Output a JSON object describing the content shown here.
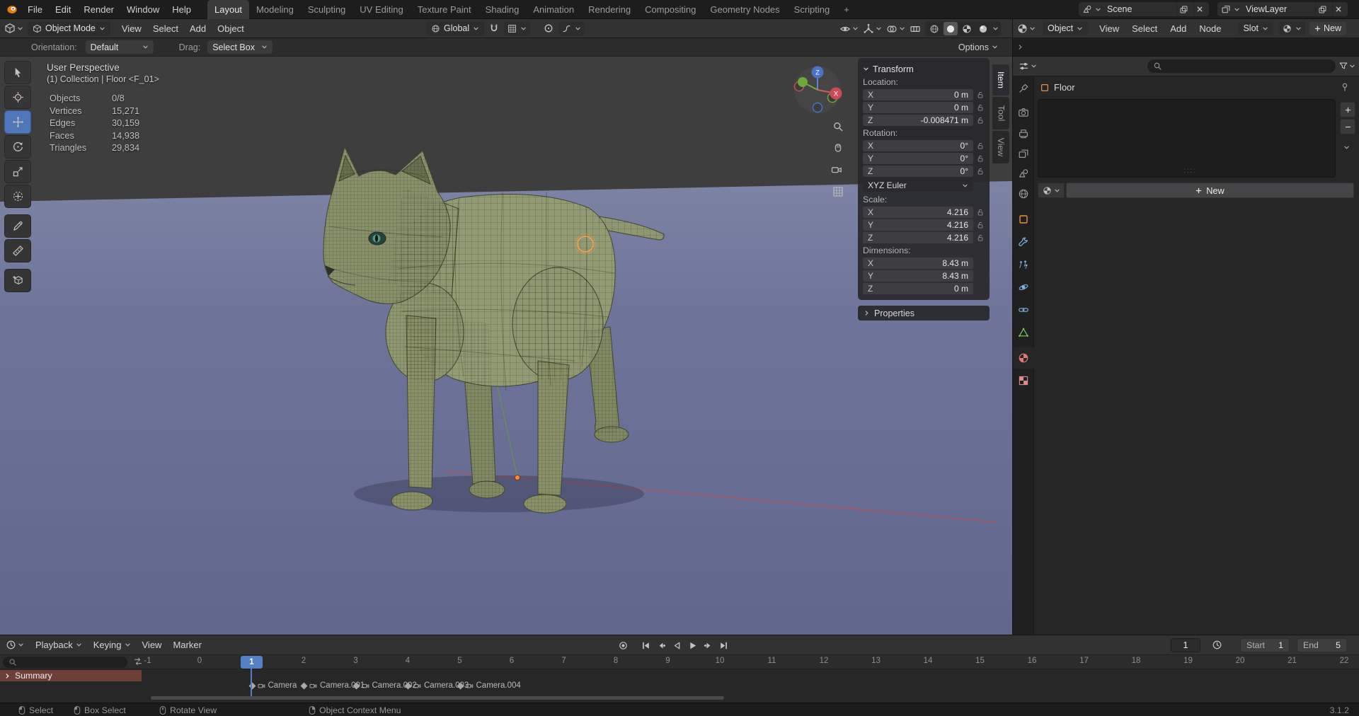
{
  "colors": {
    "accent_blue": "#4f76b8",
    "playhead_blue": "#5380c6",
    "object_orange": "#e8913c",
    "data_green": "#7fc75c",
    "material_red": "#e27777",
    "modifier_blue": "#7fb0de",
    "floor_blue": "#6f759a",
    "model_olive": "#8f9770",
    "summary_red": "#6e3f37",
    "axis_x": "#cf4a58",
    "axis_y": "#6fa63a",
    "axis_z": "#4a72c8",
    "logo_orange": "#e87d0d"
  },
  "icons": {
    "blender-logo": "orange-ellipse",
    "search-icon": "magnifier",
    "lock-open-icon": "open-padlock",
    "pin-icon": "pushpin",
    "filter-icon": "funnel",
    "camera-icon": "video-camera",
    "clock-icon": "clock",
    "magnet-icon": "horseshoe-magnet",
    "globe-icon": "globe",
    "chevron-down-icon": "v",
    "chevron-right-icon": ">",
    "plus-icon": "+",
    "minus-icon": "-",
    "close-icon": "x",
    "mouse-left-icon": "mouse-lmb",
    "mouse-middle-icon": "mouse-mmb",
    "mouse-right-icon": "mouse-rmb",
    "marker-diamond-icon": "diamond",
    "grid-icon": "grid",
    "hand-icon": "hand",
    "eye-icon": "eye"
  },
  "topbar": {
    "menus": [
      "File",
      "Edit",
      "Render",
      "Window",
      "Help"
    ],
    "workspaces": [
      "Layout",
      "Modeling",
      "Sculpting",
      "UV Editing",
      "Texture Paint",
      "Shading",
      "Animation",
      "Rendering",
      "Compositing",
      "Geometry Nodes",
      "Scripting"
    ],
    "active_workspace": "Layout",
    "add_workspace": "+",
    "scene_label": "Scene",
    "view_layer_label": "ViewLayer"
  },
  "viewport": {
    "header": {
      "mode": "Object Mode",
      "menus": [
        "View",
        "Select",
        "Add",
        "Object"
      ],
      "orientation": "Global"
    },
    "tool_settings": {
      "orientation_label": "Orientation:",
      "orientation_value": "Default",
      "drag_label": "Drag:",
      "drag_value": "Select Box",
      "options_label": "Options"
    },
    "overlay": {
      "view_label": "User Perspective",
      "context_label": "(1) Collection | Floor <F_01>"
    },
    "stats": [
      {
        "label": "Objects",
        "value": "0/8"
      },
      {
        "label": "Vertices",
        "value": "15,271"
      },
      {
        "label": "Edges",
        "value": "30,159"
      },
      {
        "label": "Faces",
        "value": "14,938"
      },
      {
        "label": "Triangles",
        "value": "29,834"
      }
    ],
    "gizmo_axes": {
      "x": "X",
      "z": "Z"
    }
  },
  "sidebar": {
    "tabs": [
      "Item",
      "Tool",
      "View"
    ],
    "active_tab": "Item",
    "transform": {
      "title": "Transform",
      "location_label": "Location:",
      "location": {
        "x": {
          "axis": "X",
          "value": "0 m"
        },
        "y": {
          "axis": "Y",
          "value": "0 m"
        },
        "z": {
          "axis": "Z",
          "value": "-0.008471 m"
        }
      },
      "rotation_label": "Rotation:",
      "rotation": {
        "x": {
          "axis": "X",
          "value": "0°"
        },
        "y": {
          "axis": "Y",
          "value": "0°"
        },
        "z": {
          "axis": "Z",
          "value": "0°"
        }
      },
      "rotation_mode": "XYZ Euler",
      "scale_label": "Scale:",
      "scale": {
        "x": {
          "axis": "X",
          "value": "4.216"
        },
        "y": {
          "axis": "Y",
          "value": "4.216"
        },
        "z": {
          "axis": "Z",
          "value": "4.216"
        }
      },
      "dimensions_label": "Dimensions:",
      "dimensions": {
        "x": {
          "axis": "X",
          "value": "8.43 m"
        },
        "y": {
          "axis": "Y",
          "value": "8.43 m"
        },
        "z": {
          "axis": "Z",
          "value": "0 m"
        }
      }
    },
    "properties_panel": "Properties"
  },
  "shader_editor": {
    "shader_type": "Object",
    "menus": [
      "View",
      "Select",
      "Add",
      "Node"
    ],
    "slot_label": "Slot",
    "new_label": "New"
  },
  "properties": {
    "breadcrumb": "Floor",
    "new_material_label": "New"
  },
  "timeline": {
    "menus": [
      "Playback",
      "Keying",
      "View",
      "Marker"
    ],
    "current_frame": "1",
    "start_label": "Start",
    "start_value": "1",
    "end_label": "End",
    "end_value": "5",
    "ruler_numbers": [
      "-1",
      "0",
      "1",
      "2",
      "3",
      "4",
      "5",
      "6",
      "7",
      "8",
      "9",
      "10",
      "11",
      "12",
      "13",
      "14",
      "15",
      "16",
      "17",
      "18",
      "19",
      "20",
      "21",
      "22"
    ],
    "summary_label": "Summary",
    "markers": [
      {
        "label": "Camera",
        "frame": 1
      },
      {
        "label": "Camera.001",
        "frame": 2
      },
      {
        "label": "Camera.002",
        "frame": 3
      },
      {
        "label": "Camera.003",
        "frame": 4
      },
      {
        "label": "Camera.004",
        "frame": 5
      }
    ]
  },
  "status_bar": {
    "items": [
      "Select",
      "Box Select",
      "Rotate View",
      "Object Context Menu"
    ],
    "version": "3.1.2"
  }
}
